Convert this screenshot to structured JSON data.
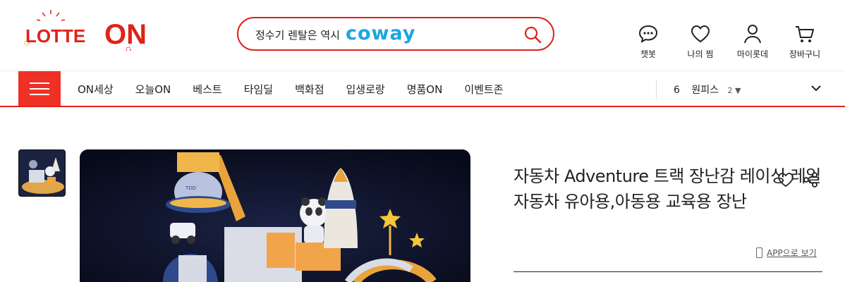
{
  "brand": {
    "logo_text_1": "LOTTE",
    "logo_text_2": "ON",
    "accent_color": "#e0221a"
  },
  "search": {
    "text": "정수기 렌탈은 역시",
    "brand_word": "coway",
    "icon": "search-icon"
  },
  "utilities": [
    {
      "label": "챗봇",
      "icon": "chat-icon"
    },
    {
      "label": "나의 찜",
      "icon": "heart-icon"
    },
    {
      "label": "마이롯데",
      "icon": "user-icon"
    },
    {
      "label": "장바구니",
      "icon": "cart-icon"
    }
  ],
  "nav": {
    "menu_icon": "hamburger-icon",
    "items": [
      "ON세상",
      "오늘ON",
      "베스트",
      "타임딜",
      "백화점",
      "입생로랑",
      "명품ON",
      "이벤트존"
    ],
    "ranking": {
      "rank": "6",
      "keyword": "원피스",
      "change": "2",
      "change_icon": "down-triangle-icon"
    },
    "expand_icon": "chevron-down-icon"
  },
  "product": {
    "title": "자동차 Adventure 트랙 장난감 레이싱 레일 자동차 유아용,아동용 교육용 장난",
    "app_link": "APP으로 보기",
    "wish_icon": "heart-icon",
    "share_icon": "share-icon"
  }
}
